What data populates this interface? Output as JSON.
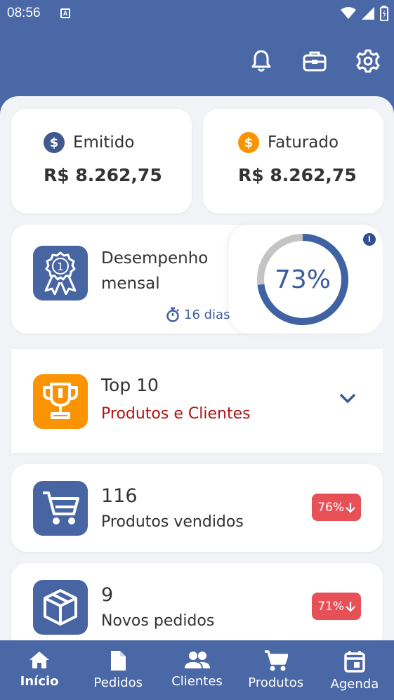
{
  "status_bar": {
    "time": "08:56",
    "badge": "A"
  },
  "header": {
    "icons": [
      "bell-icon",
      "briefcase-icon",
      "gear-icon"
    ]
  },
  "summary": {
    "emitido": {
      "label": "Emitido",
      "value": "R$ 8.262,75",
      "coin": "$"
    },
    "faturado": {
      "label": "Faturado",
      "value": "R$ 8.262,75",
      "coin": "$"
    }
  },
  "performance": {
    "title": "Desempenho mensal",
    "days": "16 dias",
    "badge_number": "1",
    "gauge_percent": 73,
    "gauge_label": "73%",
    "info": "i"
  },
  "top10": {
    "title": "Top 10",
    "subtitle": "Produtos e Clientes"
  },
  "stats": [
    {
      "value": "116",
      "label": "Produtos vendidos",
      "change": "76%"
    },
    {
      "value": "9",
      "label": "Novos pedidos",
      "change": "71%"
    }
  ],
  "nav": {
    "items": [
      {
        "label": "Início",
        "active": true
      },
      {
        "label": "Pedidos"
      },
      {
        "label": "Clientes"
      },
      {
        "label": "Produtos"
      },
      {
        "label": "Agenda"
      }
    ]
  },
  "colors": {
    "primary": "#4a68a6",
    "orange": "#fb9404",
    "red_badge": "#e85057",
    "subtitle_red": "#b31414",
    "background": "#f1f3f6"
  }
}
